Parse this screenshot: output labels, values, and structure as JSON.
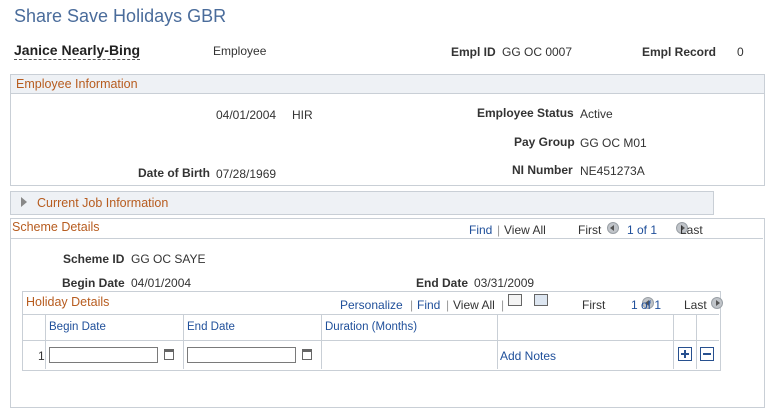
{
  "page": {
    "title": "Share Save Holidays GBR"
  },
  "employee": {
    "name": "Janice Nearly-Bing",
    "type": "Employee",
    "empl_id_label": "Empl ID",
    "empl_id": "GG OC 0007",
    "empl_record_label": "Empl Record",
    "empl_record": "0"
  },
  "employee_info": {
    "header": "Employee Information",
    "hire_date": "04/01/2004",
    "action": "HIR",
    "status_label": "Employee Status",
    "status": "Active",
    "pay_group_label": "Pay Group",
    "pay_group": "GG OC M01",
    "dob_label": "Date of Birth",
    "dob": "07/28/1969",
    "ni_label": "NI Number",
    "ni": "NE451273A"
  },
  "current_job": {
    "header": "Current Job Information"
  },
  "scheme": {
    "header": "Scheme Details",
    "find": "Find",
    "view_all": "View All",
    "first": "First",
    "count": "1 of 1",
    "last": "Last",
    "scheme_id_label": "Scheme ID",
    "scheme_id": "GG OC SAYE",
    "begin_label": "Begin Date",
    "begin": "04/01/2004",
    "end_label": "End Date",
    "end": "03/31/2009"
  },
  "holiday": {
    "header": "Holiday Details",
    "personalize": "Personalize",
    "find": "Find",
    "view_all": "View All",
    "first": "First",
    "count": "1 of 1",
    "last": "Last",
    "columns": [
      "Begin Date",
      "End Date",
      "Duration (Months)"
    ],
    "rows": [
      {
        "num": "1",
        "begin": "",
        "end": "",
        "duration": "",
        "notes": "Add Notes"
      }
    ],
    "icons": {
      "view": "grid-view-icon",
      "download": "spreadsheet-download-icon",
      "calendar": "calendar-icon",
      "add": "plus-icon",
      "delete": "minus-icon"
    }
  }
}
